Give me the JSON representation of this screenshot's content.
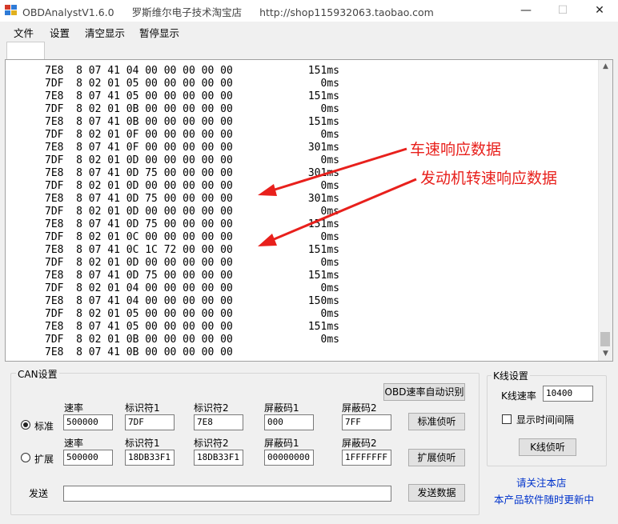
{
  "window": {
    "title": "OBDAnalystV1.6.0",
    "shop_name": "罗斯维尔电子技术淘宝店",
    "shop_url": "http://shop115932063.taobao.com",
    "minimize": "—",
    "maximize": "☐",
    "close": "✕"
  },
  "menu": [
    "文件",
    "设置",
    "清空显示",
    "暂停显示"
  ],
  "log": {
    "lines": [
      {
        "frame": "7E8  8 07 41 04 00 00 00 00 00",
        "time": "151ms"
      },
      {
        "frame": "7DF  8 02 01 05 00 00 00 00 00",
        "time": "0ms"
      },
      {
        "frame": "7E8  8 07 41 05 00 00 00 00 00",
        "time": "151ms"
      },
      {
        "frame": "7DF  8 02 01 0B 00 00 00 00 00",
        "time": "0ms"
      },
      {
        "frame": "7E8  8 07 41 0B 00 00 00 00 00",
        "time": "151ms"
      },
      {
        "frame": "7DF  8 02 01 0F 00 00 00 00 00",
        "time": "0ms"
      },
      {
        "frame": "7E8  8 07 41 0F 00 00 00 00 00",
        "time": "301ms"
      },
      {
        "frame": "7DF  8 02 01 0D 00 00 00 00 00",
        "time": "0ms"
      },
      {
        "frame": "7E8  8 07 41 0D 75 00 00 00 00",
        "time": "301ms"
      },
      {
        "frame": "7DF  8 02 01 0D 00 00 00 00 00",
        "time": "0ms"
      },
      {
        "frame": "7E8  8 07 41 0D 75 00 00 00 00",
        "time": "301ms"
      },
      {
        "frame": "7DF  8 02 01 0D 00 00 00 00 00",
        "time": "0ms"
      },
      {
        "frame": "7E8  8 07 41 0D 75 00 00 00 00",
        "time": "151ms"
      },
      {
        "frame": "7DF  8 02 01 0C 00 00 00 00 00",
        "time": "0ms"
      },
      {
        "frame": "7E8  8 07 41 0C 1C 72 00 00 00",
        "time": "151ms"
      },
      {
        "frame": "7DF  8 02 01 0D 00 00 00 00 00",
        "time": "0ms"
      },
      {
        "frame": "7E8  8 07 41 0D 75 00 00 00 00",
        "time": "151ms"
      },
      {
        "frame": "7DF  8 02 01 04 00 00 00 00 00",
        "time": "0ms"
      },
      {
        "frame": "7E8  8 07 41 04 00 00 00 00 00",
        "time": "150ms"
      },
      {
        "frame": "7DF  8 02 01 05 00 00 00 00 00",
        "time": "0ms"
      },
      {
        "frame": "7E8  8 07 41 05 00 00 00 00 00",
        "time": "151ms"
      },
      {
        "frame": "7DF  8 02 01 0B 00 00 00 00 00",
        "time": "0ms"
      },
      {
        "frame": "7E8  8 07 41 0B 00 00 00 00 00",
        "time": ""
      }
    ],
    "annotations": {
      "speed": "车速响应数据",
      "rpm": "发动机转速响应数据",
      "color": "#e8201c"
    }
  },
  "can": {
    "legend": "CAN设置",
    "auto_detect_button": "OBD速率自动识别",
    "headers": {
      "rate": "速率",
      "id1": "标识符1",
      "id2": "标识符2",
      "mask1": "屏蔽码1",
      "mask2": "屏蔽码2"
    },
    "standard": {
      "label": "标准",
      "rate": "500000",
      "id1": "7DF",
      "id2": "7E8",
      "mask1": "000",
      "mask2": "7FF",
      "button": "标准侦听",
      "selected": true
    },
    "extended": {
      "label": "扩展",
      "rate": "500000",
      "id1": "18DB33F1",
      "id2": "18DB33F1",
      "mask1": "00000000",
      "mask2": "1FFFFFFF",
      "button": "扩展侦听",
      "selected": false
    },
    "send_label": "发送",
    "send_value": "",
    "send_button": "发送数据"
  },
  "kline": {
    "legend": "K线设置",
    "rate_label": "K线速率",
    "rate_value": "10400",
    "show_interval_label": "显示时间间隔",
    "show_interval_checked": false,
    "listen_button": "K线侦听"
  },
  "footer": {
    "follow": "请关注本店",
    "update": "本产品软件随时更新中"
  }
}
